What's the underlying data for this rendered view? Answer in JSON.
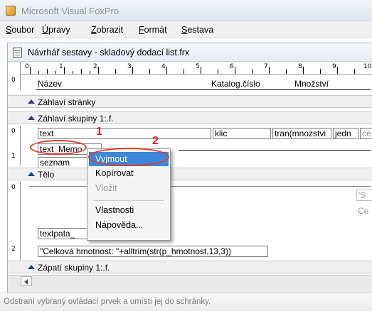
{
  "app": {
    "title": "Microsoft Visual FoxPro"
  },
  "menu": [
    "Soubor",
    "Úpravy",
    "Zobrazit",
    "Formát",
    "Sestava"
  ],
  "designer": {
    "title": "Návrhář sestavy - skladový dodací list.frx",
    "ruler_labels": [
      "0",
      "1",
      "2",
      "3",
      "4",
      "5",
      "6",
      "7",
      "8",
      "9",
      "10"
    ],
    "vruler_labels": [
      "0",
      "0",
      "1",
      "0",
      "2"
    ],
    "page_header": {
      "col_nazev": "Název",
      "col_katalog": "Katalog.číslo",
      "col_mnozstvi": "Množství"
    },
    "bands": {
      "page_header": "Záhlaví stránky",
      "group_header": "Záhlaví skupiny 1:.f.",
      "detail": "Tělo",
      "group_footer": "Zápatí skupiny 1:.f."
    },
    "fields": {
      "text": "text",
      "klic": "klic",
      "tran": "tran(mnozstvi",
      "jedn": "jedn",
      "ce": "ce",
      "text_memo": "text_Memo",
      "seznam": "seznam",
      "right_s": "'S",
      "right_ce": "Ce",
      "textpata": "textpata_",
      "celkova": "\"Celková hmotnost: \"+alltrim(str(p_hmotnost,13,3))"
    }
  },
  "context_menu": {
    "items": [
      "Vyjmout",
      "Kopírovat",
      "Vložit",
      "Vlastnosti",
      "Nápověda..."
    ],
    "highlighted": "Vyjmout",
    "disabled": "Vložit"
  },
  "annotations": {
    "num1": "1",
    "num2": "2",
    "color": "#e23b2a"
  },
  "status": {
    "text": "Odstraní vybraný ovládací prvek a umístí jej do schránky."
  }
}
